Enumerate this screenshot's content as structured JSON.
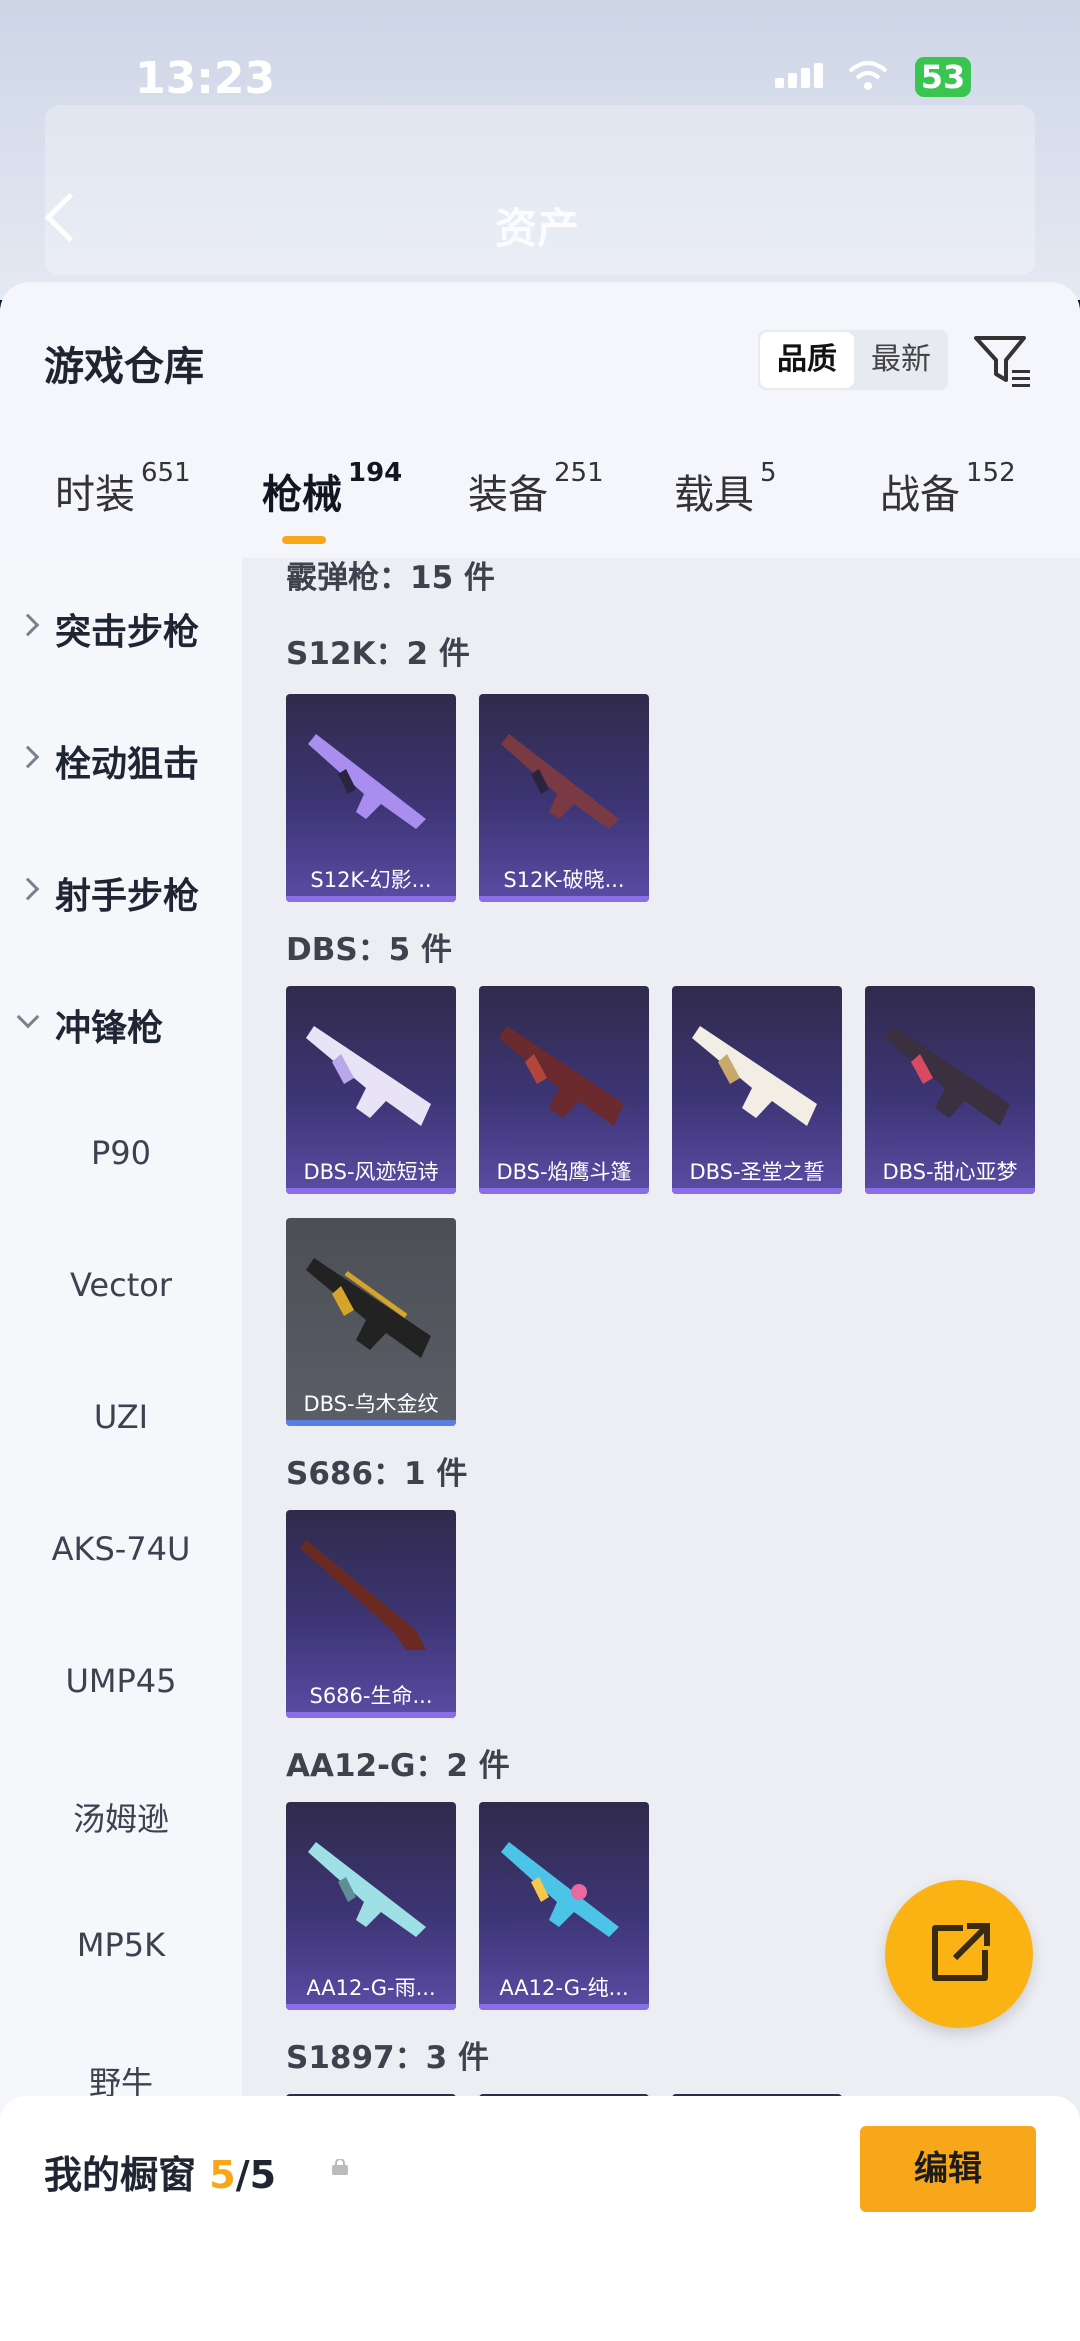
{
  "status_bar": {
    "time": "13:23",
    "battery": "53"
  },
  "header": {
    "title": "资产"
  },
  "panel": {
    "title": "游戏仓库",
    "sort": {
      "active": "品质",
      "other": "最新"
    }
  },
  "tabs": [
    {
      "label": "时装",
      "count": "651"
    },
    {
      "label": "枪械",
      "count": "194"
    },
    {
      "label": "装备",
      "count": "251"
    },
    {
      "label": "载具",
      "count": "5"
    },
    {
      "label": "战备",
      "count": "152"
    }
  ],
  "sidebar": {
    "categories": [
      "突击步枪",
      "栓动狙击",
      "射手步枪",
      "冲锋枪"
    ],
    "subitems": [
      "P90",
      "Vector",
      "UZI",
      "AKS-74U",
      "UMP45",
      "汤姆逊",
      "MP5K",
      "野牛"
    ]
  },
  "groups": [
    {
      "label": "霰弹枪：15 件",
      "items": []
    },
    {
      "label": "S12K：2 件",
      "items": [
        "S12K-幻影...",
        "S12K-破晓..."
      ]
    },
    {
      "label": "DBS：5 件",
      "items": [
        "DBS-风迹短诗",
        "DBS-焰鹰斗篷",
        "DBS-圣堂之誓",
        "DBS-甜心亚梦",
        "DBS-乌木金纹"
      ]
    },
    {
      "label": "S686：1 件",
      "items": [
        "S686-生命..."
      ]
    },
    {
      "label": "AA12-G：2 件",
      "items": [
        "AA12-G-雨...",
        "AA12-G-纯..."
      ]
    },
    {
      "label": "S1897：3 件",
      "items": []
    }
  ],
  "bottom": {
    "label": "我的橱窗",
    "count": "5",
    "total": "/5",
    "edit": "编辑"
  },
  "colors": {
    "accent": "#f7a719",
    "card_purple": "#3e3576",
    "card_gray": "#5b5e66"
  }
}
